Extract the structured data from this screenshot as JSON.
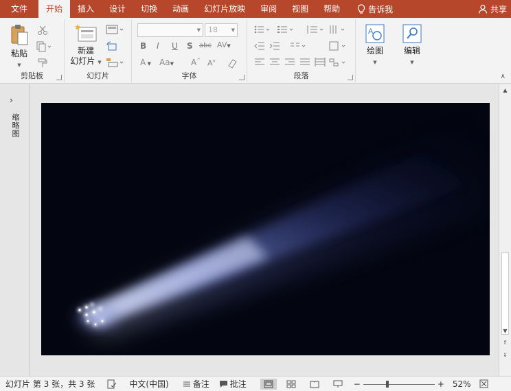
{
  "tabs": {
    "file": "文件",
    "home": "开始",
    "insert": "插入",
    "design": "设计",
    "transitions": "切换",
    "animations": "动画",
    "slideshow": "幻灯片放映",
    "review": "审阅",
    "view": "视图",
    "help": "帮助",
    "tell_me": "告诉我",
    "share": "共享"
  },
  "ribbon": {
    "clipboard": {
      "label": "剪贴板",
      "paste": "粘贴"
    },
    "slides": {
      "label": "幻灯片",
      "new_slide_line1": "新建",
      "new_slide_line2": "幻灯片"
    },
    "font": {
      "label": "字体",
      "font_size": "18"
    },
    "paragraph": {
      "label": "段落"
    },
    "drawing": {
      "label": "绘图"
    },
    "editing": {
      "label": "编辑"
    }
  },
  "left_pane": {
    "label": "缩略图"
  },
  "status": {
    "slide_info": "幻灯片 第 3 张，共 3 张",
    "language": "中文(中国)",
    "notes": "备注",
    "comments": "批注",
    "zoom": "52%"
  },
  "colors": {
    "accent": "#b7472a",
    "ribbon_bg": "#f3f3f3",
    "slide_bg": "#030510"
  }
}
